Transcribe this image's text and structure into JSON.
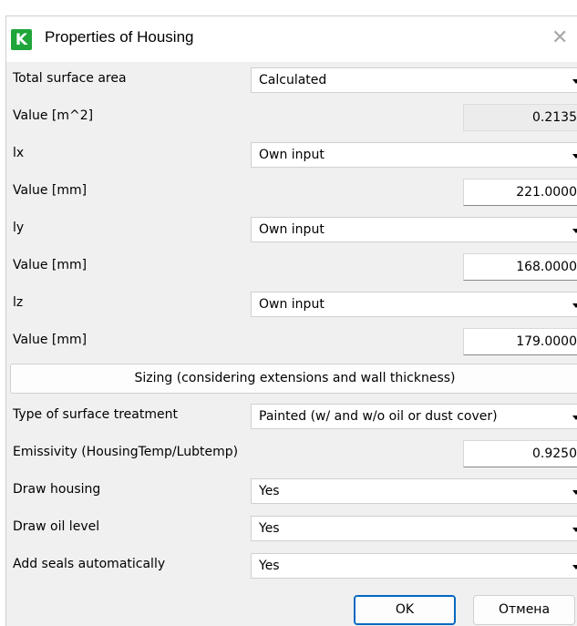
{
  "window": {
    "title": "Properties of Housing",
    "icon_letter": "K",
    "close_glyph": "✕"
  },
  "rows": [
    {
      "label": "Total surface area",
      "type": "combo",
      "value": "Calculated"
    },
    {
      "label": "Value [m^2]",
      "type": "readonly",
      "value": "0.2135"
    },
    {
      "label": "lx",
      "type": "combo",
      "value": "Own input"
    },
    {
      "label": "Value [mm]",
      "type": "number",
      "value": "221.0000"
    },
    {
      "label": "ly",
      "type": "combo",
      "value": "Own input"
    },
    {
      "label": "Value [mm]",
      "type": "number",
      "value": "168.0000"
    },
    {
      "label": "lz",
      "type": "combo",
      "value": "Own input"
    },
    {
      "label": "Value [mm]",
      "type": "number",
      "value": "179.0000"
    },
    {
      "label": "Sizing (considering extensions and wall thickness)",
      "type": "button"
    },
    {
      "label": "Type of surface treatment",
      "type": "combo",
      "value": "Painted (w/ and w/o oil or dust cover)"
    },
    {
      "label": "Emissivity (HousingTemp/Lubtemp)",
      "type": "number",
      "value": "0.9250"
    },
    {
      "label": "Draw housing",
      "type": "combo",
      "value": "Yes"
    },
    {
      "label": "Draw oil level",
      "type": "combo",
      "value": "Yes"
    },
    {
      "label": "Add seals automatically",
      "type": "combo",
      "value": "Yes"
    }
  ],
  "footer": {
    "ok_label": "OK",
    "cancel_label": "Отмена"
  },
  "colors": {
    "icon_green": "#1fa53a",
    "dialog_bg": "#f0f0f0",
    "ok_border": "#0067c0"
  }
}
